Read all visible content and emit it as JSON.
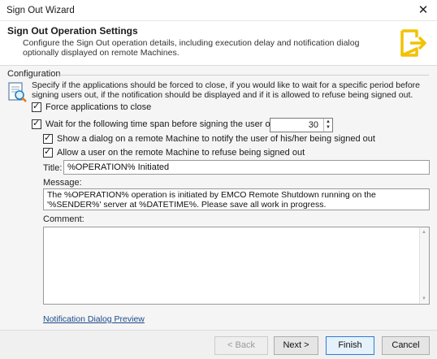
{
  "window": {
    "title": "Sign Out Wizard",
    "close_glyph": "✕"
  },
  "header": {
    "title": "Sign Out Operation Settings",
    "description": "Configure the Sign Out operation details, including execution delay and notification dialog optionally displayed on remote Machines.",
    "icon": "exit-door-icon",
    "accent_color": "#f2c200"
  },
  "configuration": {
    "group_label": "Configuration",
    "description": "Specify if the applications should be forced to close, if you would like to wait for a specific period before signing users out, if the notification should be displayed and if it is allowed to refuse being signed out.",
    "force_close": {
      "label": "Force applications to close",
      "checked": true
    },
    "wait": {
      "label": "Wait for the following time span before signing the user out (sec):",
      "checked": true,
      "value": "30"
    },
    "show_dialog": {
      "label": "Show a dialog on a remote Machine to notify the user of his/her being signed out",
      "checked": true
    },
    "allow_refuse": {
      "label": "Allow a user on the remote Machine to refuse being signed out",
      "checked": true
    },
    "title_label": "Title:",
    "title_value": "%OPERATION% Initiated",
    "message_label": "Message:",
    "message_value": "The %OPERATION% operation is initiated by EMCO Remote Shutdown running on the '%SENDER%' server at %DATETIME%. Please save all work in progress.",
    "comment_label": "Comment:",
    "comment_value": "",
    "preview_link": "Notification Dialog Preview"
  },
  "footer": {
    "back_label": "< Back",
    "next_label": "Next >",
    "finish_label": "Finish",
    "cancel_label": "Cancel"
  }
}
